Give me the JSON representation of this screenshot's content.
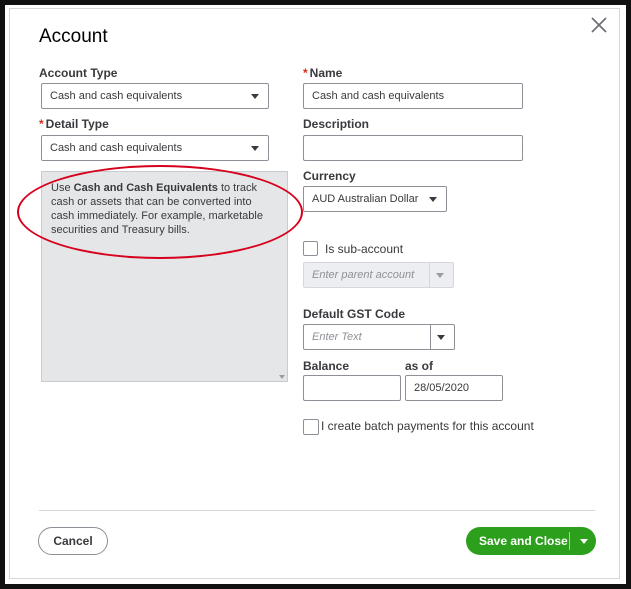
{
  "dialog": {
    "title": "Account",
    "close_icon": "close-icon"
  },
  "left": {
    "account_type_label": "Account Type",
    "account_type_value": "Cash and cash equivalents",
    "detail_type_required": "*",
    "detail_type_label": "Detail Type",
    "detail_type_value": "Cash and cash equivalents",
    "description_prefix": "Use ",
    "description_bold": "Cash and Cash Equivalents",
    "description_rest": " to track cash or assets that can be converted into cash immediately. For example, marketable securities and Treasury bills."
  },
  "right": {
    "name_required": "*",
    "name_label": "Name",
    "name_value": "Cash and cash equivalents",
    "description_label": "Description",
    "description_value": "",
    "currency_label": "Currency",
    "currency_value": "AUD Australian Dollar",
    "sub_account_label": "Is sub-account",
    "parent_account_placeholder": "Enter parent account",
    "gst_label": "Default GST Code",
    "gst_placeholder": "Enter Text",
    "balance_label": "Balance",
    "balance_value": "",
    "as_of_label": "as of",
    "as_of_value": "28/05/2020",
    "batch_payments_label": "I create batch payments for this account"
  },
  "footer": {
    "cancel_label": "Cancel",
    "save_label": "Save and Close"
  },
  "colors": {
    "primary_green": "#2ca01c",
    "required_red": "#d52b1e",
    "annotation_red": "#d6001c"
  }
}
